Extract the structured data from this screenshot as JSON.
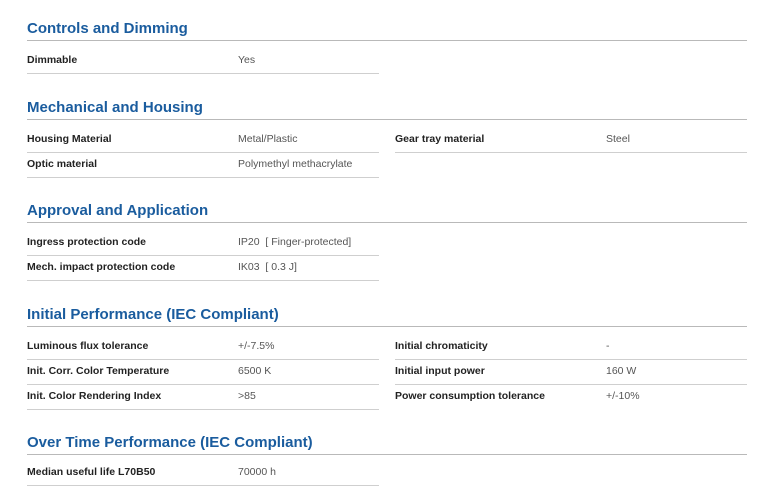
{
  "sections": [
    {
      "title": "Controls and Dimming",
      "left": [
        {
          "label": "Dimmable",
          "value": "Yes"
        }
      ],
      "right": []
    },
    {
      "title": "Mechanical and Housing",
      "left": [
        {
          "label": "Housing Material",
          "value": "Metal/Plastic"
        },
        {
          "label": "Optic material",
          "value": "Polymethyl methacrylate"
        }
      ],
      "right": [
        {
          "label": "Gear tray material",
          "value": "Steel"
        }
      ]
    },
    {
      "title": "Approval and Application",
      "left": [
        {
          "label": "Ingress protection code",
          "value": "IP20  [ Finger-protected]"
        },
        {
          "label": "Mech. impact protection code",
          "value": "IK03  [ 0.3 J]"
        }
      ],
      "right": []
    },
    {
      "title": "Initial Performance (IEC Compliant)",
      "left": [
        {
          "label": "Luminous flux tolerance",
          "value": "+/-7.5%"
        },
        {
          "label": "Init. Corr. Color Temperature",
          "value": "6500 K"
        },
        {
          "label": "Init. Color Rendering Index",
          "value": ">85"
        }
      ],
      "right": [
        {
          "label": "Initial chromaticity",
          "value": "-"
        },
        {
          "label": "Initial input power",
          "value": "160 W"
        },
        {
          "label": "Power consumption tolerance",
          "value": "+/-10%"
        }
      ]
    },
    {
      "title": "Over Time Performance (IEC Compliant)",
      "left": [
        {
          "label": "Median useful life L70B50",
          "value": "70000 h"
        }
      ],
      "right": []
    }
  ]
}
